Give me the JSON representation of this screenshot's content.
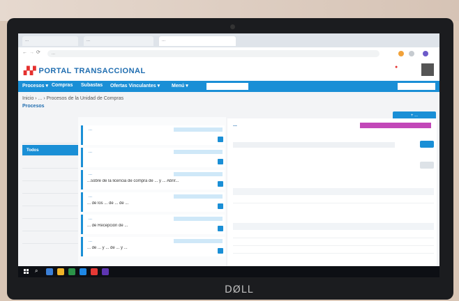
{
  "browser": {
    "tabs": [
      "...",
      "...",
      "..."
    ],
    "url": "..."
  },
  "portal": {
    "logo_brand": "PORTAL",
    "logo_rest": " TRANSACCIONAL",
    "nav": [
      "Procesos ▾",
      "Compras",
      "Subastas",
      "Ofertas Vinculantes ▾",
      "Menú ▾"
    ],
    "nav_search_placeholder": "",
    "top_search_placeholder": "",
    "user_text": "",
    "breadcrumb": "Inicio › ... › Procesos de la Unidad de Compras",
    "page_title": "Procesos",
    "new_process_button": "+ ..."
  },
  "sidebar": {
    "items": [
      "",
      "Todos",
      "",
      "",
      "",
      "",
      "",
      "",
      ""
    ]
  },
  "list": {
    "header": "",
    "cards": [
      {
        "title": "...",
        "badge": "",
        "desc": ""
      },
      {
        "title": "...",
        "badge": "",
        "desc": ""
      },
      {
        "title": "...",
        "badge": "",
        "desc": "...sobre de la licencia de compra de ... y ... Abrir..."
      },
      {
        "title": "...",
        "badge": "",
        "desc": "... de los ... de ... de ..."
      },
      {
        "title": "...",
        "badge": "",
        "desc": "... de Recepción de ..."
      },
      {
        "title": "...",
        "badge": "",
        "desc": "... de ... y ... de ... y ..."
      }
    ],
    "pager": ""
  },
  "detail": {
    "title": "...",
    "status": "",
    "subtitle": "",
    "link_text": "",
    "section1": "",
    "table1": {
      "headers": [
        "",
        "",
        ""
      ],
      "rows": [
        [
          "",
          "",
          ""
        ]
      ]
    },
    "section2": "",
    "table2": {
      "headers": [
        "",
        "",
        "",
        ""
      ],
      "rows": [
        [
          "",
          "",
          "",
          ""
        ],
        [
          "",
          "",
          "",
          ""
        ],
        [
          "",
          "",
          "",
          ""
        ]
      ]
    }
  },
  "taskbar": {
    "time": "",
    "date": ""
  },
  "laptop_brand": "DØLL"
}
